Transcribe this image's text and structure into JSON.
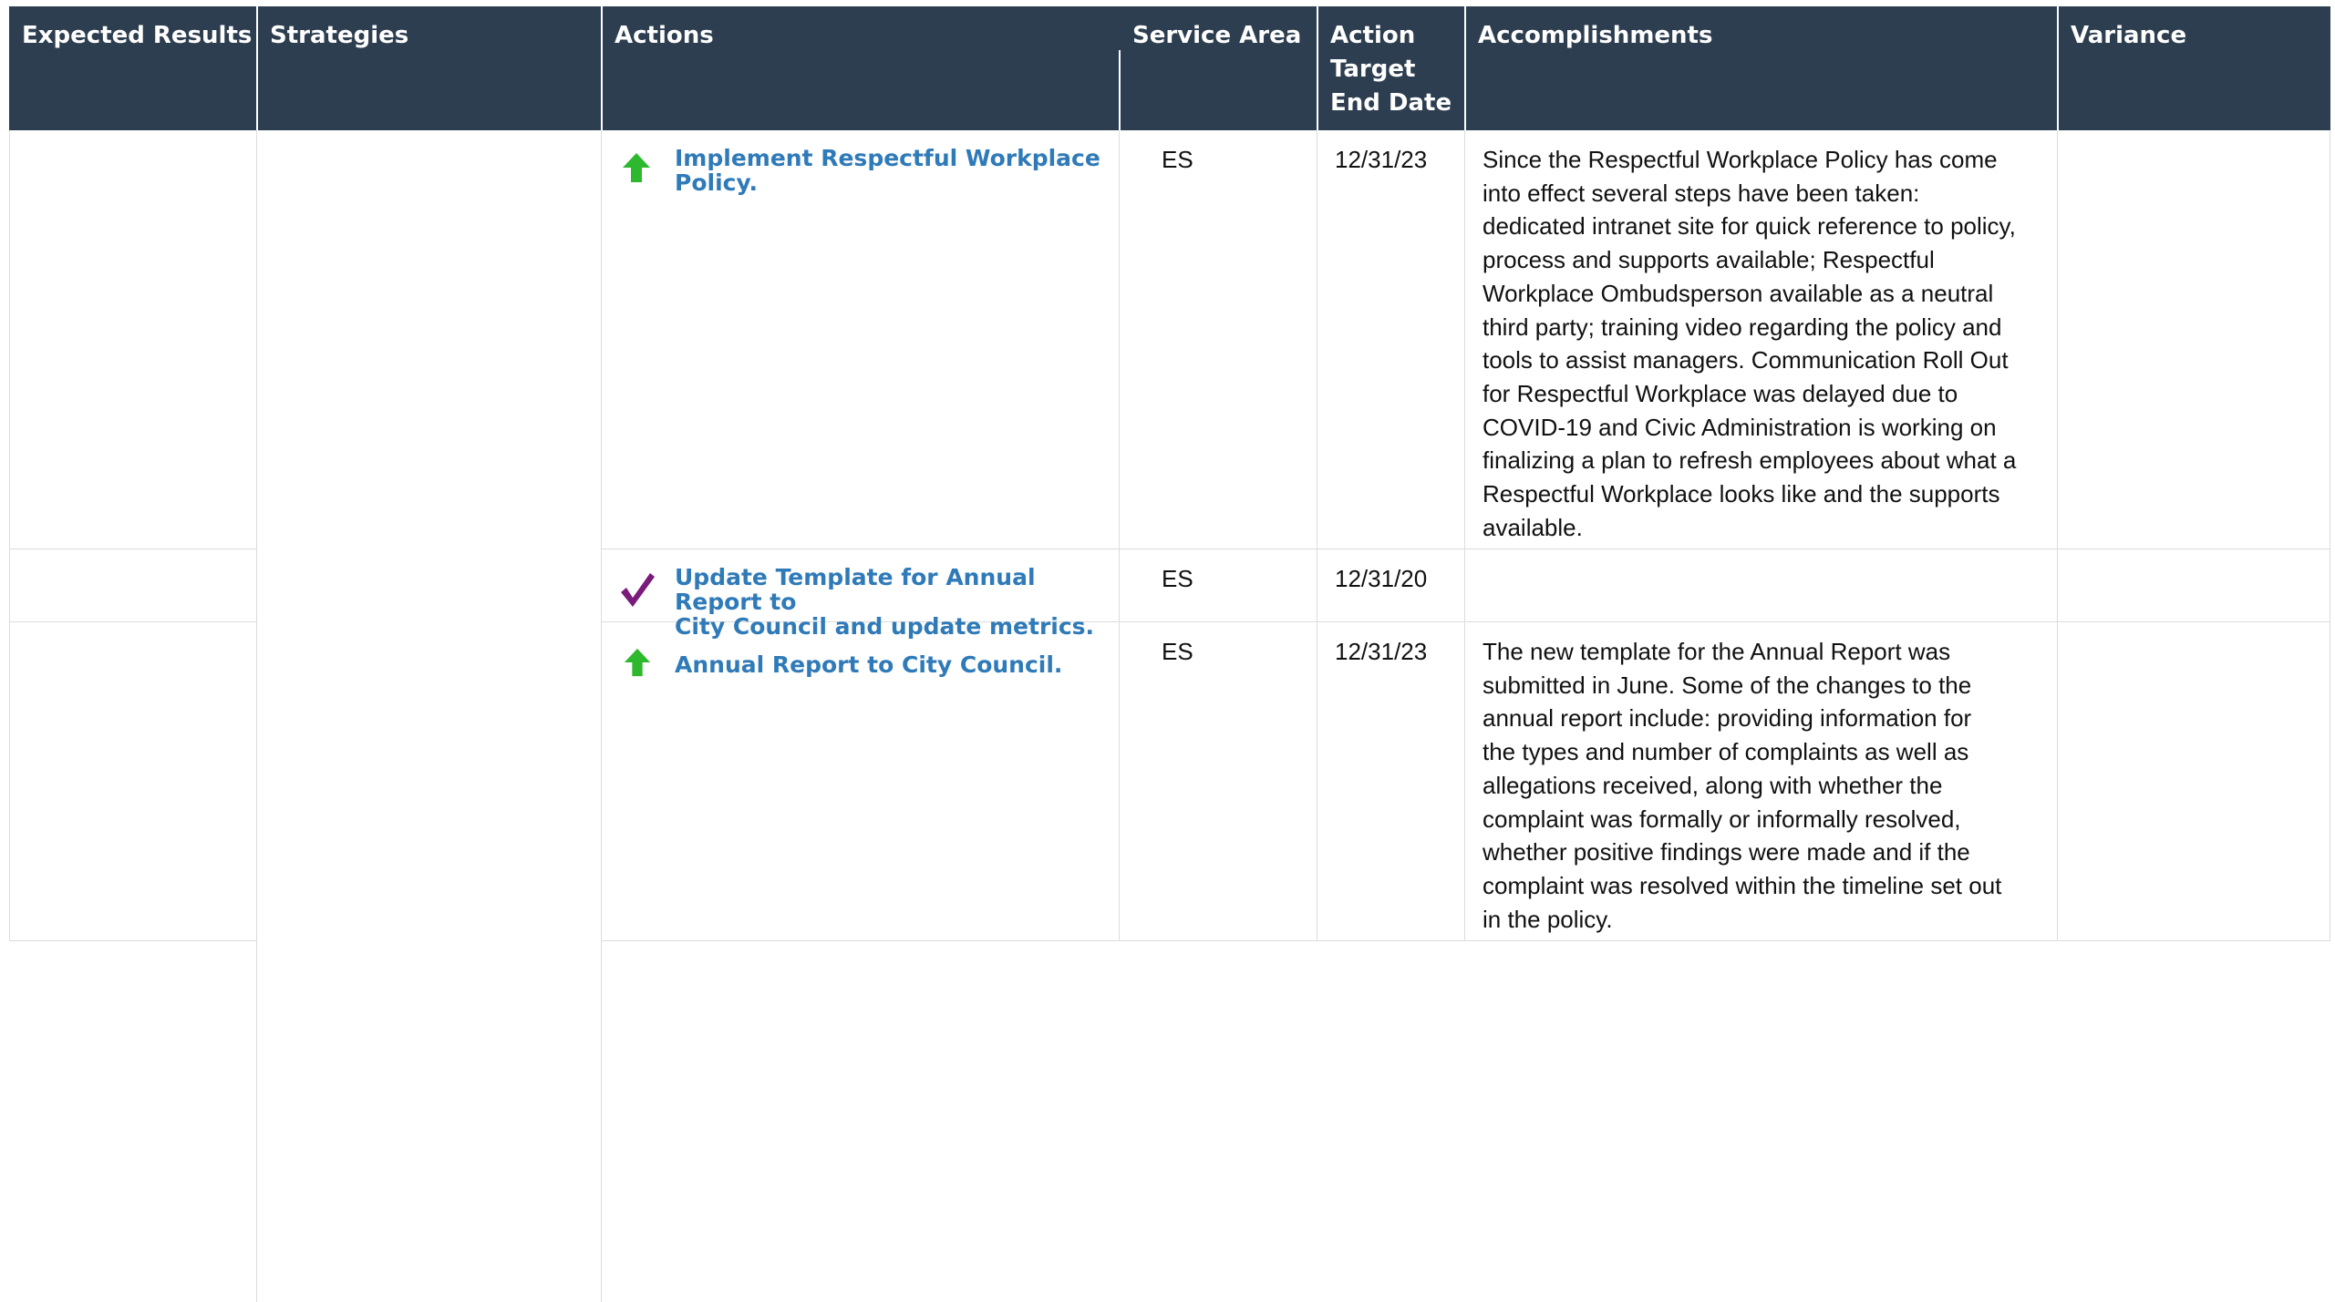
{
  "headers": {
    "expected_results": "Expected Results",
    "strategies": "Strategies",
    "actions": "Actions",
    "service_area": "Service Area",
    "action_target_end_date": [
      "Action",
      "Target",
      "End Date"
    ],
    "accomplishments": "Accomplishments",
    "variance": "Variance"
  },
  "rows": [
    {
      "status_icon": "up-arrow-icon",
      "action": [
        "Implement Respectful Workplace",
        "Policy."
      ],
      "service_area": "ES",
      "target_end_date": "12/31/23",
      "accomplishments": [
        "Since the Respectful Workplace Policy has come",
        "into effect several steps have been taken:",
        "dedicated intranet site for quick reference to policy,",
        "process and supports available; Respectful",
        "Workplace Ombudsperson available as a neutral",
        "third party; training video regarding the policy and",
        "tools to assist managers. Communication Roll Out",
        "for Respectful Workplace was delayed due to",
        "COVID-19 and Civic Administration is working on",
        "finalizing a plan to refresh employees about what a",
        "Respectful Workplace looks like and the supports",
        "available."
      ],
      "variance": ""
    },
    {
      "status_icon": "checkmark-icon",
      "action": [
        "Update Template for Annual Report to",
        "City Council and update metrics."
      ],
      "service_area": "ES",
      "target_end_date": "12/31/20",
      "accomplishments": [],
      "variance": ""
    },
    {
      "status_icon": "up-arrow-icon",
      "action": [
        "Annual Report to City Council."
      ],
      "service_area": "ES",
      "target_end_date": "12/31/23",
      "accomplishments": [
        "The new template for the Annual Report was",
        "submitted in June.  Some of the changes to the",
        "annual report include: providing information for",
        "the types and number of complaints as well as",
        "allegations received, along with whether the",
        "complaint was formally or informally resolved,",
        "whether positive findings were made and if the",
        "complaint was resolved within the timeline set out",
        "in the policy."
      ],
      "variance": ""
    }
  ],
  "colors": {
    "header_bg": "#2d3e50",
    "header_text": "#ffffff",
    "link": "#2f7ab8",
    "arrow_green": "#2eb82e",
    "check_purple": "#7a1a7a",
    "grid": "#dcdcdc"
  }
}
